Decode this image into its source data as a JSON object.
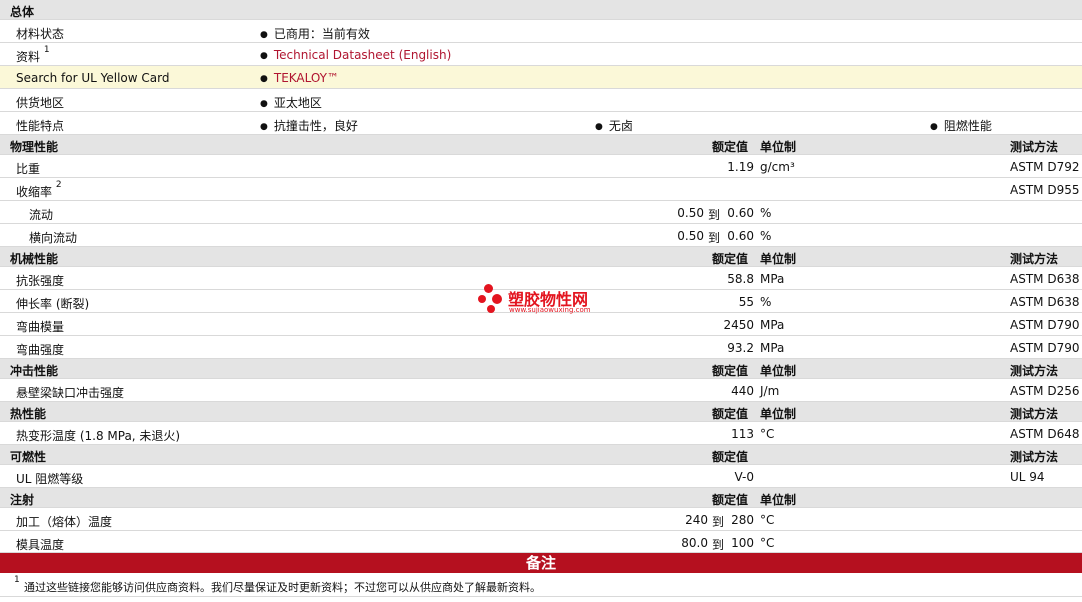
{
  "general": {
    "header": "总体",
    "material_status_label": "材料状态",
    "material_status_value": "已商用：当前有效",
    "source_label": "资料",
    "source_sup": "1",
    "source_link": "Technical Datasheet (English)",
    "ul_search_label": "Search for UL Yellow Card",
    "ul_search_link": "TEKALOY™",
    "region_label": "供货地区",
    "region_value": "亚太地区",
    "features_label": "性能特点",
    "features": [
      "抗撞击性，良好",
      "无卤",
      "阻燃性能"
    ]
  },
  "physical": {
    "header": "物理性能",
    "col_nominal": "额定值",
    "col_unit": "单位制",
    "col_method": "测试方法",
    "sg_label": "比重",
    "sg_value": "1.19",
    "sg_unit": "g/cm³",
    "sg_method": "ASTM D792",
    "shrink_label": "收缩率",
    "shrink_sup": "2",
    "shrink_method": "ASTM D955",
    "flow_label": "流动",
    "flow_low": "0.50",
    "flow_to": "到",
    "flow_high": "0.60",
    "flow_unit": "%",
    "tflow_label": "横向流动",
    "tflow_low": "0.50",
    "tflow_to": "到",
    "tflow_high": "0.60",
    "tflow_unit": "%"
  },
  "mechanical": {
    "header": "机械性能",
    "col_nominal": "额定值",
    "col_unit": "单位制",
    "col_method": "测试方法",
    "rows": [
      {
        "label": "抗张强度",
        "value": "58.8",
        "unit": "MPa",
        "method": "ASTM D638"
      },
      {
        "label": "伸长率 (断裂)",
        "value": "55",
        "unit": "%",
        "method": "ASTM D638"
      },
      {
        "label": "弯曲模量",
        "value": "2450",
        "unit": "MPa",
        "method": "ASTM D790"
      },
      {
        "label": "弯曲强度",
        "value": "93.2",
        "unit": "MPa",
        "method": "ASTM D790"
      }
    ]
  },
  "impact": {
    "header": "冲击性能",
    "col_nominal": "额定值",
    "col_unit": "单位制",
    "col_method": "测试方法",
    "label": "悬壁梁缺口冲击强度",
    "value": "440",
    "unit": "J/m",
    "method": "ASTM D256"
  },
  "thermal": {
    "header": "热性能",
    "col_nominal": "额定值",
    "col_unit": "单位制",
    "col_method": "测试方法",
    "label": "热变形温度 (1.8 MPa, 未退火)",
    "value": "113",
    "unit": "°C",
    "method": "ASTM D648"
  },
  "flammability": {
    "header": "可燃性",
    "col_nominal": "额定值",
    "col_method": "测试方法",
    "label": "UL 阻燃等级",
    "value": "V-0",
    "method": "UL 94"
  },
  "injection": {
    "header": "注射",
    "col_nominal": "额定值",
    "col_unit": "单位制",
    "melt_label": "加工（熔体）温度",
    "melt_low": "240",
    "melt_to": "到",
    "melt_high": "280",
    "melt_unit": "°C",
    "mold_label": "模具温度",
    "mold_low": "80.0",
    "mold_to": "到",
    "mold_high": "100",
    "mold_unit": "°C"
  },
  "notes": {
    "header": "备注",
    "note1_num": "1",
    "note1_text": "通过这些链接您能够访问供应商资料。我们尽量保证及时更新资料；不过您可以从供应商处了解最新资料。"
  },
  "watermark": {
    "name": "塑胶物性网",
    "url": "www.sujiaowuxing.com",
    "color": "#e3141f"
  },
  "colors": {
    "section_bg": "#e4e4e4",
    "highlight_bg": "#fbf8d8",
    "banner_bg": "#b5101f",
    "link": "#b01530"
  }
}
